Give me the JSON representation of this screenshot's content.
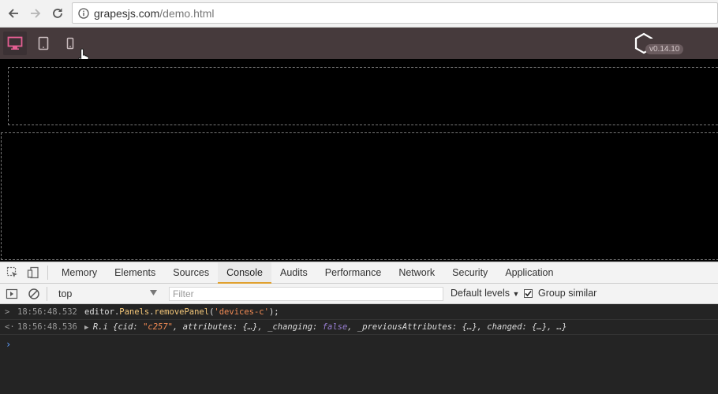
{
  "browser": {
    "url_host": "grapesjs.com",
    "url_path": "/demo.html"
  },
  "editor": {
    "devices": [
      "desktop",
      "tablet",
      "mobile"
    ],
    "active_device": "desktop",
    "version": "v0.14.10",
    "accent": "#e55f93"
  },
  "devtools": {
    "tabs": [
      "Memory",
      "Elements",
      "Sources",
      "Console",
      "Audits",
      "Performance",
      "Network",
      "Security",
      "Application"
    ],
    "active_tab": "Console",
    "context": "top",
    "filter_placeholder": "Filter",
    "levels": "Default levels",
    "group_similar": "Group similar"
  },
  "console": {
    "lines": [
      {
        "timestamp": "18:56:48.532",
        "obj": "editor",
        "dot1": ".",
        "prop1": "Panels",
        "dot2": ".",
        "method": "removePanel",
        "open": "(",
        "arg": "'devices-c'",
        "close": ");"
      },
      {
        "timestamp": "18:56:48.536",
        "type": "R.i",
        "p1": " {cid: ",
        "cid": "\"c257\"",
        "p2": ", attributes: {…}, _changing: ",
        "flag": "false",
        "p3": ", _previousAttributes: {…}, changed: {…}, …}"
      }
    ]
  }
}
